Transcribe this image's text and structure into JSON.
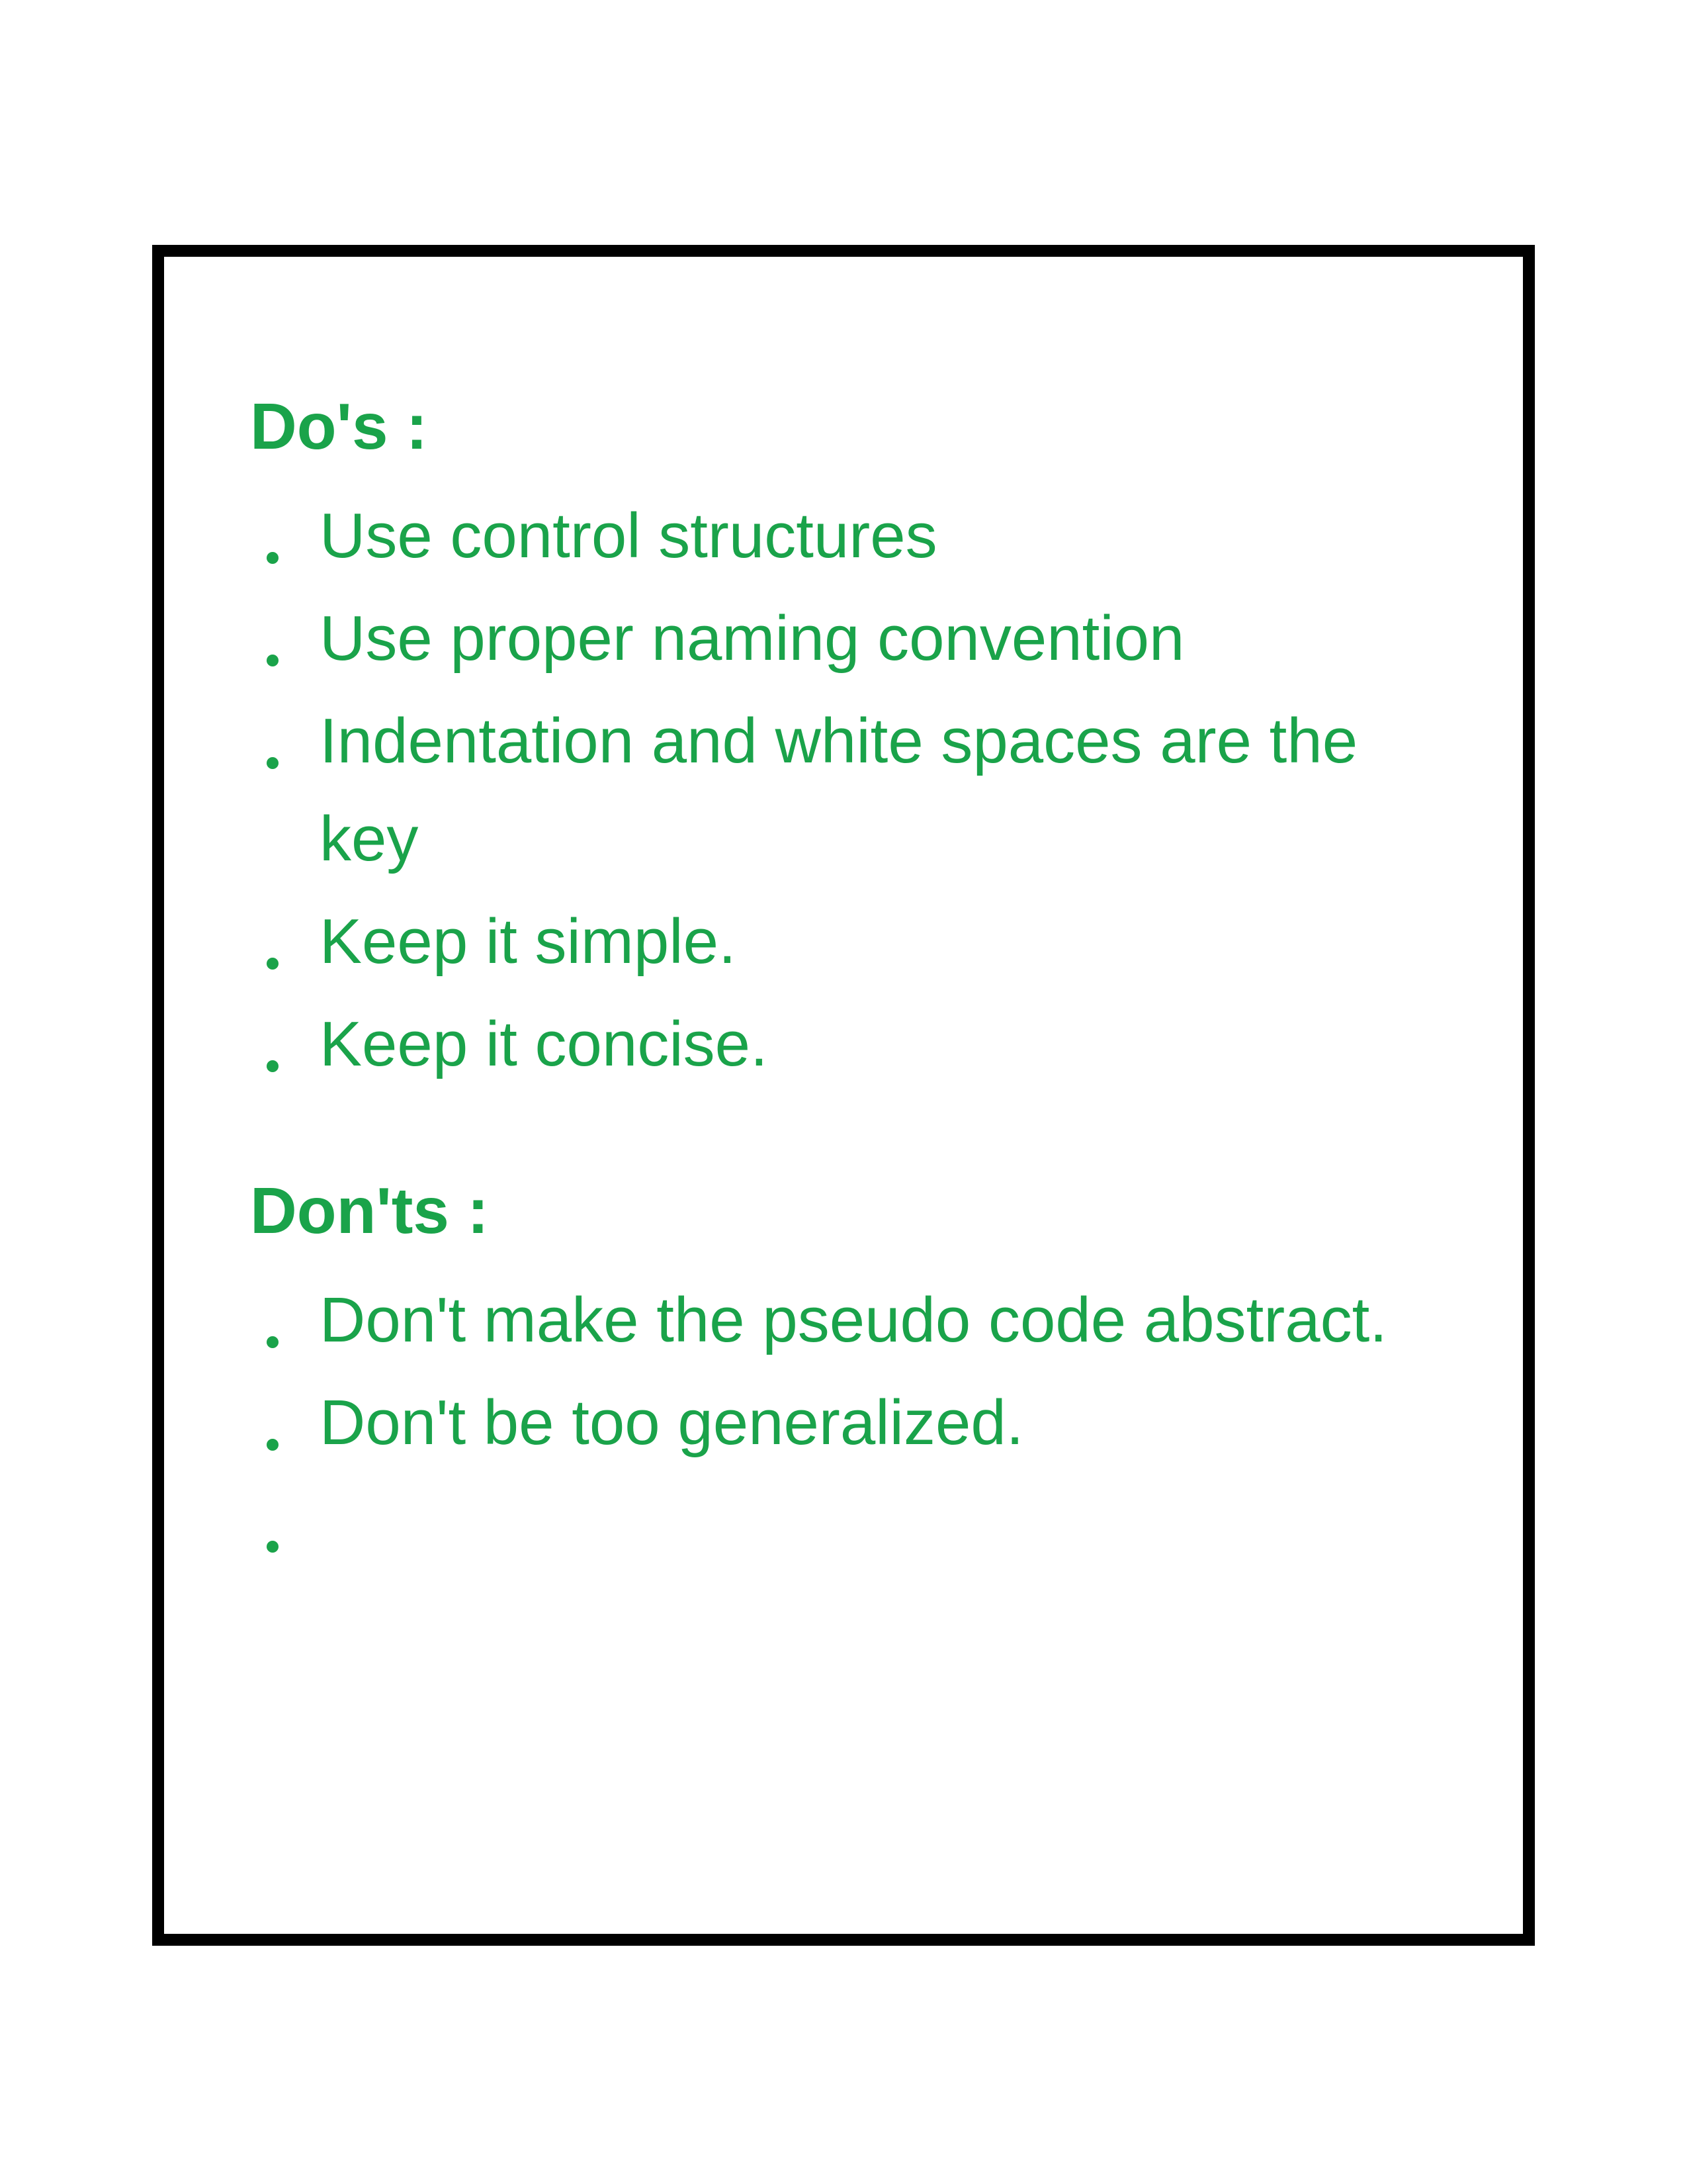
{
  "dos": {
    "heading": "Do's  :",
    "items": [
      "Use control structures",
      "Use proper naming convention",
      "Indentation and white spaces are the key",
      "Keep it simple.",
      "Keep it concise."
    ]
  },
  "donts": {
    "heading": "Don'ts :",
    "items": [
      "Don't make the pseudo code abstract.",
      "Don't  be too generalized.",
      ""
    ]
  },
  "colors": {
    "text": "#1aa34a",
    "border": "#000000"
  }
}
